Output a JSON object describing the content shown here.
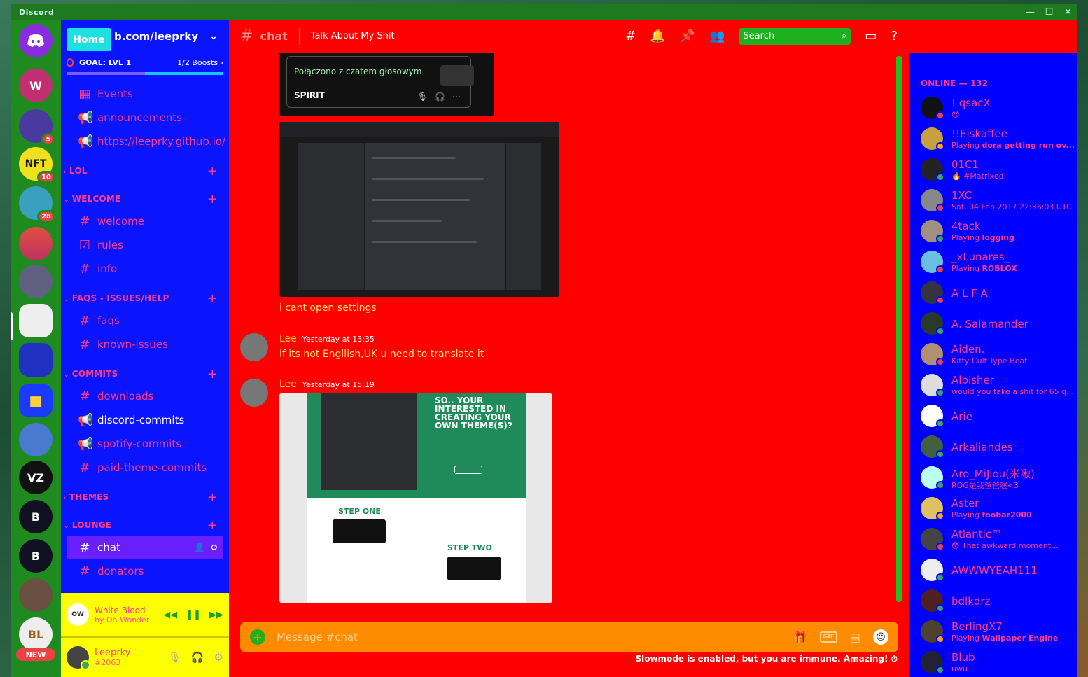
{
  "window": {
    "brand": "Discord",
    "controls": [
      "—",
      "☐",
      "✕"
    ]
  },
  "servers": {
    "badges": [
      "5",
      "10",
      "28"
    ],
    "new_label": "NEW",
    "folder_icon": "folder-icon",
    "discord_icon": "discord-logo-icon"
  },
  "channel_sidebar": {
    "home_tooltip": "Home",
    "server_name": "b.com/leeprky",
    "goal": {
      "label": "GOAL: LVL 1",
      "boosts": "1/2 Boosts ›",
      "progress": 0.5
    },
    "top_items": [
      {
        "icon": "calendar-icon",
        "label": "Events"
      },
      {
        "icon": "megaphone-icon",
        "label": "announcements"
      },
      {
        "icon": "megaphone-icon",
        "label": "https://leeprky.github.io/"
      }
    ],
    "categories": [
      {
        "name": "LOL",
        "collapsed": true,
        "channels": []
      },
      {
        "name": "WELCOME",
        "channels": [
          {
            "icon": "hash-icon",
            "label": "welcome"
          },
          {
            "icon": "rules-icon",
            "label": "rules"
          },
          {
            "icon": "hash-icon",
            "label": "info"
          }
        ]
      },
      {
        "name": "FAQS - ISSUES/HELP",
        "channels": [
          {
            "icon": "hash-icon",
            "label": "faqs"
          },
          {
            "icon": "hash-icon",
            "label": "known-issues"
          }
        ]
      },
      {
        "name": "COMMITS",
        "channels": [
          {
            "icon": "hash-icon",
            "label": "downloads"
          },
          {
            "icon": "megaphone-icon",
            "label": "discord-commits"
          },
          {
            "icon": "megaphone-icon",
            "label": "spotify-commits"
          },
          {
            "icon": "hash-icon",
            "label": "paid-theme-commits"
          }
        ]
      },
      {
        "name": "THEMES",
        "collapsed": true,
        "channels": []
      },
      {
        "name": "LOUNGE",
        "channels": [
          {
            "icon": "hash-icon",
            "label": "chat",
            "active": true
          },
          {
            "icon": "hash-icon",
            "label": "donators"
          }
        ]
      }
    ]
  },
  "now_playing": {
    "cover": "OW",
    "title": "White Blood",
    "artist": "by Oh Wonder"
  },
  "user_panel": {
    "username": "Leeprky",
    "tag": "#2063"
  },
  "topbar": {
    "hash": "#",
    "channel": "chat",
    "topic": "Talk About My Shit",
    "search_placeholder": "Search"
  },
  "messages": {
    "voice_embed": {
      "text": "Połączono z czatem głosowym",
      "user": "SPIRIT"
    },
    "caption": "i cant open settings",
    "items": [
      {
        "author": "Lee",
        "time": "Yesterday at 13:35",
        "text": "if its not Engllish,UK u need to translate it"
      },
      {
        "author": "Lee",
        "time": "Yesterday at 15:19",
        "text": ""
      }
    ],
    "theme_image": {
      "headline": "SO.. YOUR INTERESTED IN CREATING YOUR OWN THEME(S)?",
      "step1": "STEP ONE",
      "step2": "STEP TWO"
    }
  },
  "composer": {
    "placeholder": "Message #chat",
    "gif": "GIF",
    "slowmode": "Slowmode is enabled, but you are immune. Amazing!"
  },
  "members": {
    "section": "ONLINE — 132",
    "list": [
      {
        "name": "! qsacX",
        "sub": "😎",
        "status": "#ed4245"
      },
      {
        "name": "!!Eiskaffee",
        "sub_prefix": "Playing ",
        "sub_bold": "dora getting run ov...",
        "status": "#faa61a"
      },
      {
        "name": "01C1",
        "sub": "🔥 #Matrixed",
        "status": "#3ba55d"
      },
      {
        "name": "1XC",
        "sub": "Sat, 04 Feb 2017 22:36:03 UTC",
        "status": "#ed4245"
      },
      {
        "name": "4tack",
        "sub_prefix": "Playing ",
        "sub_bold": "logging",
        "status": "#3ba55d"
      },
      {
        "name": "_xLunares_",
        "sub_prefix": "Playing ",
        "sub_bold": "ROBLOX",
        "status": "#ed4245"
      },
      {
        "name": "A L F A",
        "status": "#ed4245"
      },
      {
        "name": "A. Salamander",
        "status": "#3ba55d"
      },
      {
        "name": "Aiden.",
        "sub": "Kitty Cult Type Beat",
        "status": "#ed4245"
      },
      {
        "name": "Albisher",
        "sub": "would you take a shit for 65 qu...",
        "status": "#3ba55d"
      },
      {
        "name": "Arie",
        "status": "#3ba55d"
      },
      {
        "name": "Arkaliandes",
        "status": "#3ba55d"
      },
      {
        "name": "Aro_MiJiou(米啾)",
        "sub": "ROG是我爸爸喔<3",
        "status": "#3ba55d"
      },
      {
        "name": "Aster",
        "sub_prefix": "Playing ",
        "sub_bold": "foobar2000",
        "status": "#faa61a"
      },
      {
        "name": "Atlantic™",
        "sub": "😳 That awkward moment...",
        "status": "#ed4245"
      },
      {
        "name": "AWWWYEAH111",
        "status": "#3ba55d"
      },
      {
        "name": "bdlkdrz",
        "status": "#3ba55d"
      },
      {
        "name": "BerlingX7",
        "sub_prefix": "Playing ",
        "sub_bold": "Wallpaper Engine",
        "status": "#faa61a"
      },
      {
        "name": "Blub",
        "sub": "uwu",
        "status": "#3ba55d"
      }
    ]
  }
}
